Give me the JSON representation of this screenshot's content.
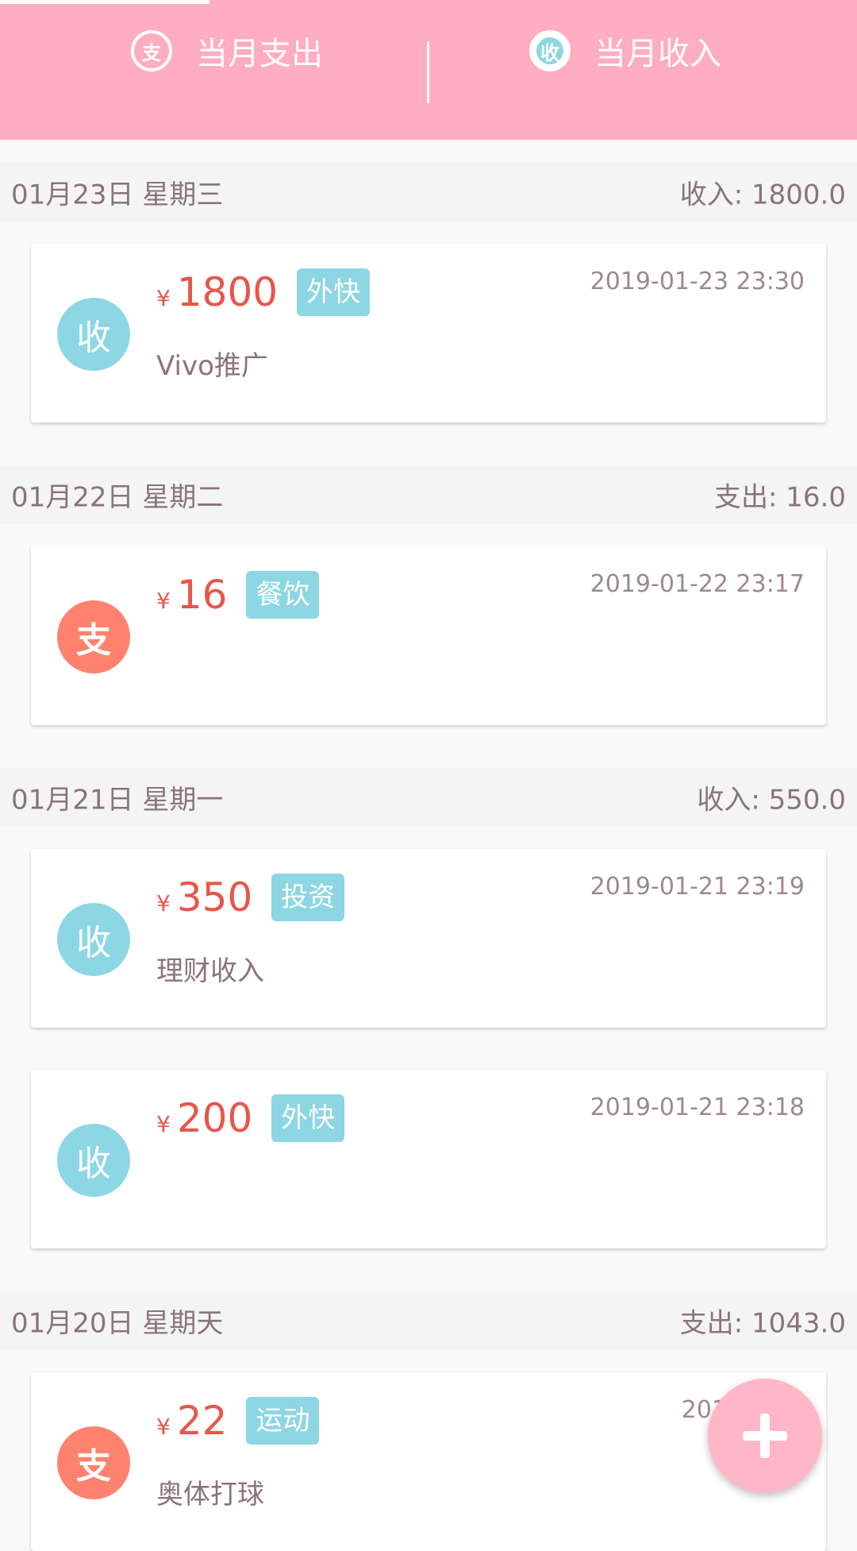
{
  "header": {
    "tabs": [
      {
        "label": "当月支出",
        "icon_char": "支",
        "icon": "expense-icon"
      },
      {
        "label": "当月收入",
        "icon_char": "收",
        "icon": "income-icon"
      }
    ]
  },
  "days": [
    {
      "date": "01月23日 星期三",
      "total": "收入: 1800.0"
    },
    {
      "date": "01月22日 星期二",
      "total": "支出: 16.0"
    },
    {
      "date": "01月21日 星期一",
      "total": "收入: 550.0"
    },
    {
      "date": "01月20日 星期天",
      "total": "支出: 1043.0"
    }
  ],
  "records": [
    {
      "type_char": "收",
      "currency": "¥",
      "amount": "1800",
      "tag": "外快",
      "time": "2019-01-23 23:30",
      "note": "Vivo推广"
    },
    {
      "type_char": "支",
      "currency": "¥",
      "amount": "16",
      "tag": "餐饮",
      "time": "2019-01-22 23:17",
      "note": ""
    },
    {
      "type_char": "收",
      "currency": "¥",
      "amount": "350",
      "tag": "投资",
      "time": "2019-01-21 23:19",
      "note": "理财收入"
    },
    {
      "type_char": "收",
      "currency": "¥",
      "amount": "200",
      "tag": "外快",
      "time": "2019-01-21 23:18",
      "note": ""
    },
    {
      "type_char": "支",
      "currency": "¥",
      "amount": "22",
      "tag": "运动",
      "time": "2019-01-2",
      "note": "奥体打球"
    }
  ],
  "fab": {
    "icon": "plus-icon"
  },
  "colors": {
    "header": "#ffadc0",
    "income": "#8dd6e4",
    "expense": "#ff826e",
    "amount": "#e8564a",
    "fab": "#ffb6c7"
  }
}
